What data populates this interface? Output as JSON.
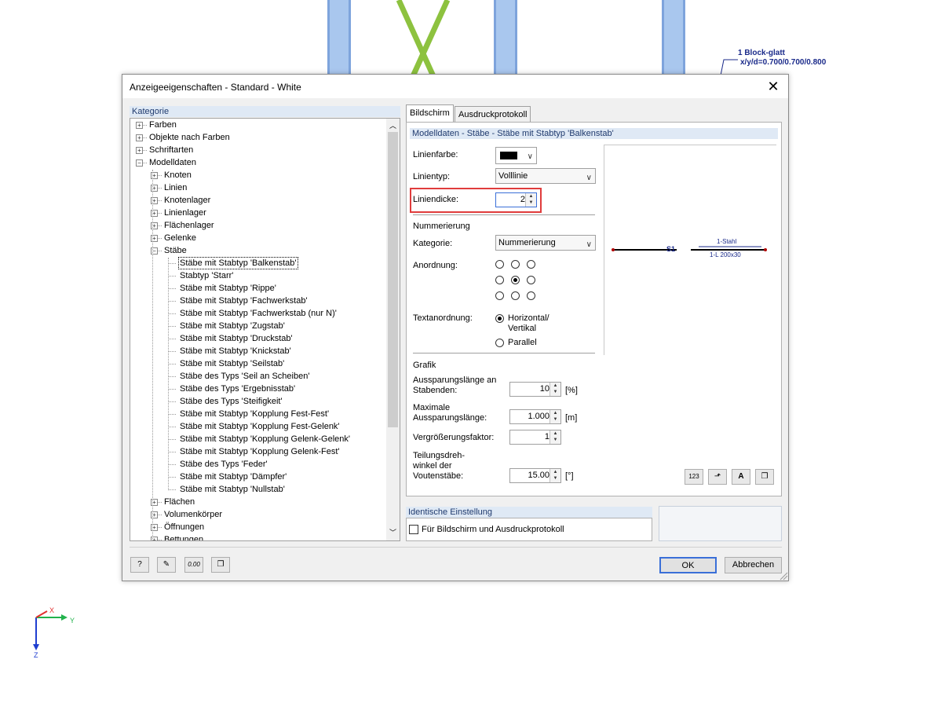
{
  "background": {
    "block_label": "1 Block-glatt",
    "block_values": "x/y/d=0.700/0.700/0.800",
    "axes": {
      "x": "X",
      "y": "Y",
      "z": "Z"
    }
  },
  "dialog": {
    "title": "Anzeigeeigenschaften - Standard - White",
    "category_header": "Kategorie",
    "tree": [
      {
        "label": "Farben",
        "level": 0,
        "expander": "+"
      },
      {
        "label": "Objekte nach Farben",
        "level": 0,
        "expander": "+"
      },
      {
        "label": "Schriftarten",
        "level": 0,
        "expander": "+"
      },
      {
        "label": "Modelldaten",
        "level": 0,
        "expander": "-"
      },
      {
        "label": "Knoten",
        "level": 1,
        "expander": "+"
      },
      {
        "label": "Linien",
        "level": 1,
        "expander": "+"
      },
      {
        "label": "Knotenlager",
        "level": 1,
        "expander": "+"
      },
      {
        "label": "Linienlager",
        "level": 1,
        "expander": "+"
      },
      {
        "label": "Flächenlager",
        "level": 1,
        "expander": "+"
      },
      {
        "label": "Gelenke",
        "level": 1,
        "expander": "+"
      },
      {
        "label": "Stäbe",
        "level": 1,
        "expander": "-"
      },
      {
        "label": "Stäbe mit Stabtyp 'Balkenstab'",
        "level": 2,
        "expander": "",
        "selected": true
      },
      {
        "label": "Stabtyp 'Starr'",
        "level": 2,
        "expander": ""
      },
      {
        "label": "Stäbe mit Stabtyp 'Rippe'",
        "level": 2,
        "expander": ""
      },
      {
        "label": "Stäbe mit Stabtyp 'Fachwerkstab'",
        "level": 2,
        "expander": ""
      },
      {
        "label": "Stäbe mit Stabtyp 'Fachwerkstab (nur N)'",
        "level": 2,
        "expander": ""
      },
      {
        "label": "Stäbe mit Stabtyp 'Zugstab'",
        "level": 2,
        "expander": ""
      },
      {
        "label": "Stäbe mit Stabtyp 'Druckstab'",
        "level": 2,
        "expander": ""
      },
      {
        "label": "Stäbe mit Stabtyp 'Knickstab'",
        "level": 2,
        "expander": ""
      },
      {
        "label": "Stäbe mit Stabtyp 'Seilstab'",
        "level": 2,
        "expander": ""
      },
      {
        "label": "Stäbe des Typs 'Seil an Scheiben'",
        "level": 2,
        "expander": ""
      },
      {
        "label": "Stäbe des Typs 'Ergebnisstab'",
        "level": 2,
        "expander": ""
      },
      {
        "label": "Stäbe des Typs 'Steifigkeit'",
        "level": 2,
        "expander": ""
      },
      {
        "label": "Stäbe mit Stabtyp 'Kopplung Fest-Fest'",
        "level": 2,
        "expander": ""
      },
      {
        "label": "Stäbe mit Stabtyp 'Kopplung Fest-Gelenk'",
        "level": 2,
        "expander": ""
      },
      {
        "label": "Stäbe mit Stabtyp 'Kopplung Gelenk-Gelenk'",
        "level": 2,
        "expander": ""
      },
      {
        "label": "Stäbe mit Stabtyp 'Kopplung Gelenk-Fest'",
        "level": 2,
        "expander": ""
      },
      {
        "label": "Stäbe des Typs 'Feder'",
        "level": 2,
        "expander": ""
      },
      {
        "label": "Stäbe mit Stabtyp 'Dämpfer'",
        "level": 2,
        "expander": ""
      },
      {
        "label": "Stäbe mit Stabtyp 'Nullstab'",
        "level": 2,
        "expander": ""
      },
      {
        "label": "Flächen",
        "level": 1,
        "expander": "+"
      },
      {
        "label": "Volumenkörper",
        "level": 1,
        "expander": "+"
      },
      {
        "label": "Öffnungen",
        "level": 1,
        "expander": "+"
      },
      {
        "label": "Bettungen",
        "level": 1,
        "expander": "+"
      }
    ],
    "tabs": {
      "screen": "Bildschirm",
      "print": "Ausdruckprotokoll"
    },
    "section_header": "Modelldaten - Stäbe - Stäbe mit Stabtyp 'Balkenstab'",
    "line_color_label": "Linienfarbe:",
    "line_color_value": "#000000",
    "line_type_label": "Linientyp:",
    "line_type_value": "Volllinie",
    "line_width_label": "Liniendicke:",
    "line_width_value": "2",
    "highlight_color": "#e03c3c",
    "numbering_title": "Nummerierung",
    "category_label": "Kategorie:",
    "category_value": "Nummerierung",
    "arrangement_label": "Anordnung:",
    "arrangement_selected": 4,
    "text_arrangement_label": "Textanordnung:",
    "text_opt1_line1": "Horizontal/",
    "text_opt1_line2": "Vertikal",
    "text_opt2": "Parallel",
    "preview": {
      "member": "S1",
      "material": "1-Stahl",
      "section": "1-L 200x30"
    },
    "grafik_title": "Grafik",
    "gap_label_l1": "Aussparungslänge an",
    "gap_label_l2": "Stabenden:",
    "gap_value": "10",
    "gap_unit": "[%]",
    "max_gap_label_l1": "Maximale",
    "max_gap_label_l2": "Aussparungslänge:",
    "max_gap_value": "1.000",
    "max_gap_unit": "[m]",
    "scale_label": "Vergrößerungsfaktor:",
    "scale_value": "1",
    "angle_label_l1": "Teilungsdreh-",
    "angle_label_l2": "winkel der",
    "angle_label_l3": "Voutenstäbe:",
    "angle_value": "15.00",
    "angle_unit": "[°]",
    "identical_header": "Identische Einstellung",
    "identical_checkbox": "Für Bildschirm und Ausdruckprotokoll",
    "ok": "OK",
    "cancel": "Abbrechen",
    "numfmt_icon_text": "0.00"
  }
}
